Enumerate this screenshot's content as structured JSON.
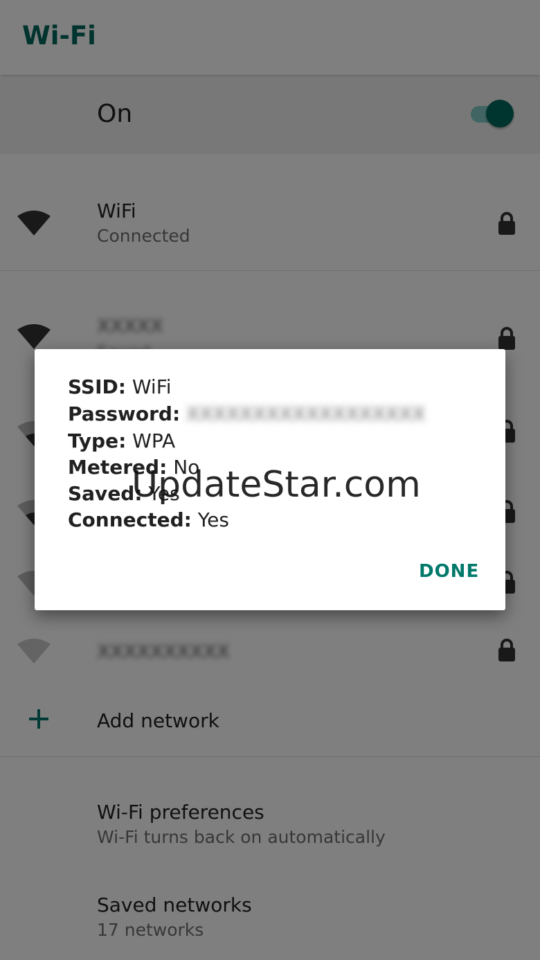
{
  "header": {
    "title": "Wi-Fi"
  },
  "master_switch": {
    "label": "On",
    "state": "on",
    "track_color": "#80cbc4",
    "thumb_color": "#00695c"
  },
  "networks": [
    {
      "name": "WiFi",
      "status": "Connected",
      "signal_icon": "wifi-full-icon",
      "lock_icon": "lock-icon"
    },
    {
      "name": "XXXXX",
      "status": "Saved",
      "signal_icon": "wifi-full-icon",
      "lock_icon": "lock-icon"
    },
    {
      "name": "XXXXXXXXXX",
      "status": "",
      "signal_icon": "wifi-weak-icon",
      "lock_icon": "lock-icon"
    }
  ],
  "add_network": {
    "label": "Add network",
    "icon": "plus-icon"
  },
  "preferences": [
    {
      "title": "Wi-Fi preferences",
      "subtitle": "Wi-Fi turns back on automatically"
    },
    {
      "title": "Saved networks",
      "subtitle": "17 networks"
    }
  ],
  "dialog": {
    "lines": [
      {
        "key": "SSID:",
        "value": "WiFi"
      },
      {
        "key": "Password:",
        "value": "XXXXXXXXXXXXXXXXXX"
      },
      {
        "key": "Type:",
        "value": "WPA"
      },
      {
        "key": "Metered:",
        "value": "No"
      },
      {
        "key": "Saved:",
        "value": "Yes"
      },
      {
        "key": "Connected:",
        "value": "Yes"
      }
    ],
    "done_label": "DONE"
  },
  "watermark": "UpdateStar.com",
  "colors": {
    "accent": "#00796b",
    "text_primary": "#212121",
    "text_secondary": "#6f6f6f"
  }
}
